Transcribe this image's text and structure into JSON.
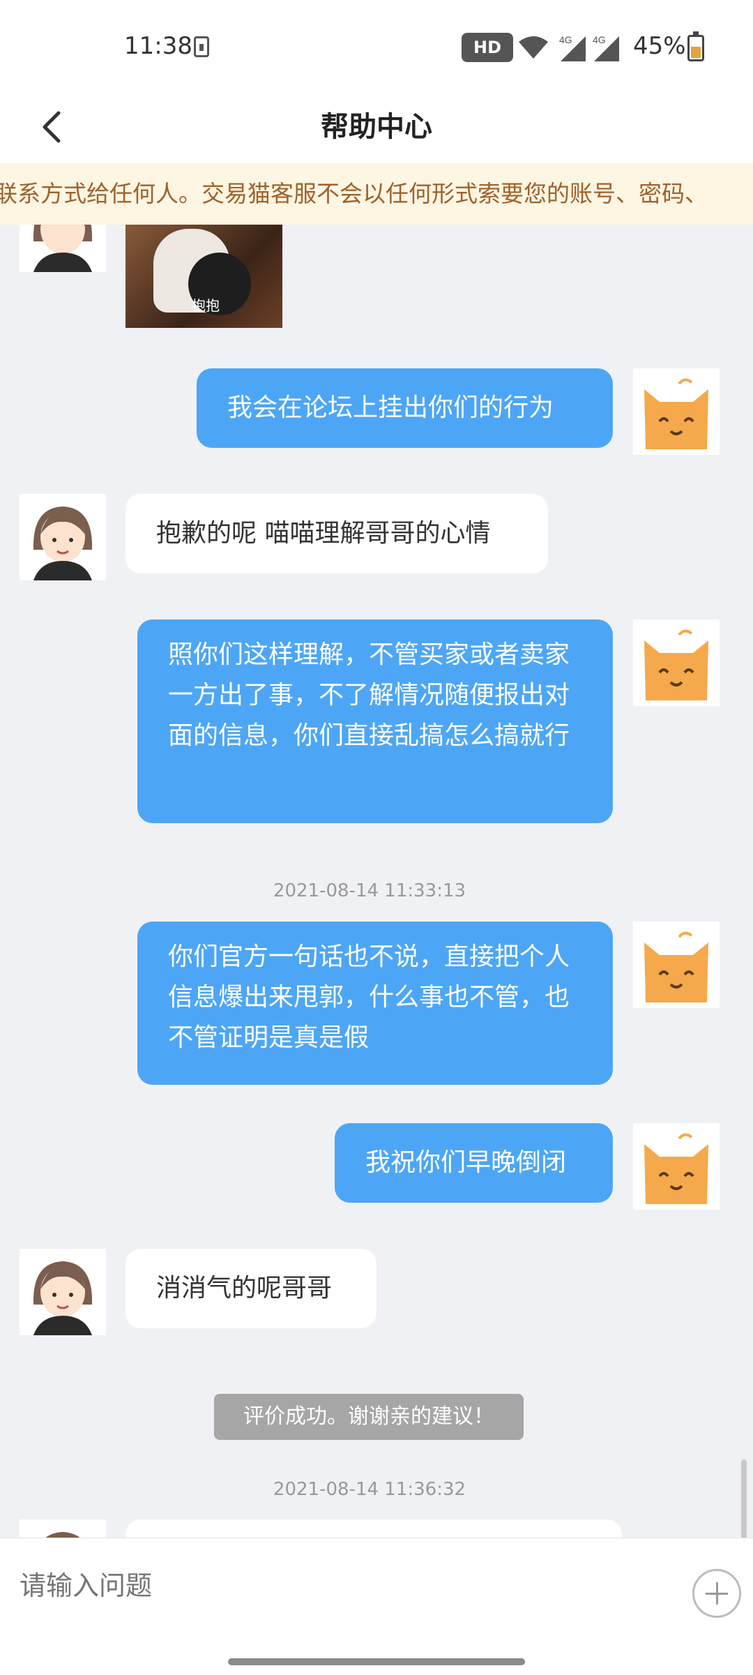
{
  "status_bar": {
    "time": "11:38",
    "hd_badge": "HD",
    "network_label_1": "4G",
    "network_label_2": "4G",
    "battery_percent": "45%",
    "icons": [
      "download-icon",
      "wifi-icon",
      "signal-icon",
      "battery-icon"
    ]
  },
  "nav": {
    "title": "帮助中心",
    "back_icon": "chevron-left-icon"
  },
  "notice": {
    "text": "联系方式给任何人。交易猫客服不会以任何形式索要您的账号、密码、"
  },
  "chat": {
    "sticker_caption": "抱抱",
    "messages": [
      {
        "side": "me",
        "text": "我会在论坛上挂出你们的行为"
      },
      {
        "side": "cs",
        "text": "抱歉的呢 喵喵理解哥哥的心情"
      },
      {
        "side": "me",
        "text": "照你们这样理解，不管买家或者卖家一方出了事，不了解情况随便报出对面的信息，你们直接乱搞怎么搞就行"
      },
      {
        "side": "me",
        "text": "你们官方一句话也不说，直接把个人信息爆出来甩郭，什么事也不管，也不管证明是真是假"
      },
      {
        "side": "me",
        "text": "我祝你们早晚倒闭"
      },
      {
        "side": "cs",
        "text": "消消气的呢哥哥"
      }
    ],
    "timestamps": [
      "2021-08-14 11:33:13",
      "2021-08-14 11:36:32"
    ],
    "system_message": "评价成功。谢谢亲的建议！",
    "colors": {
      "my_bubble": "#4DA6F5",
      "cs_bubble": "#FFFFFF",
      "background": "#F0F1F4"
    }
  },
  "input": {
    "placeholder": "请输入问题",
    "plus_icon": "plus-circle-icon"
  }
}
